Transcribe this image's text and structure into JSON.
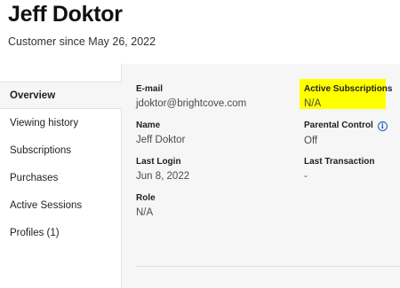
{
  "customer": {
    "name": "Jeff Doktor",
    "since": "Customer since May 26, 2022"
  },
  "sidebar": {
    "items": [
      {
        "label": "Overview",
        "active": true
      },
      {
        "label": "Viewing history",
        "active": false
      },
      {
        "label": "Subscriptions",
        "active": false
      },
      {
        "label": "Purchases",
        "active": false
      },
      {
        "label": "Active Sessions",
        "active": false
      },
      {
        "label": "Profiles (1)",
        "active": false
      }
    ]
  },
  "details": {
    "email": {
      "label": "E-mail",
      "value": "jdoktor@brightcove.com"
    },
    "name": {
      "label": "Name",
      "value": "Jeff Doktor"
    },
    "last_login": {
      "label": "Last Login",
      "value": "Jun 8, 2022"
    },
    "role": {
      "label": "Role",
      "value": "N/A"
    },
    "active_subscriptions": {
      "label": "Active Subscriptions",
      "value": "N/A"
    },
    "parental_control": {
      "label": "Parental Control",
      "value": "Off",
      "icon": "info-icon"
    },
    "last_transaction": {
      "label": "Last Transaction",
      "value": "-"
    }
  },
  "colors": {
    "highlight": "#ffff00",
    "info_icon": "#1e5fc6",
    "panel_bg": "#f6f6f6"
  }
}
